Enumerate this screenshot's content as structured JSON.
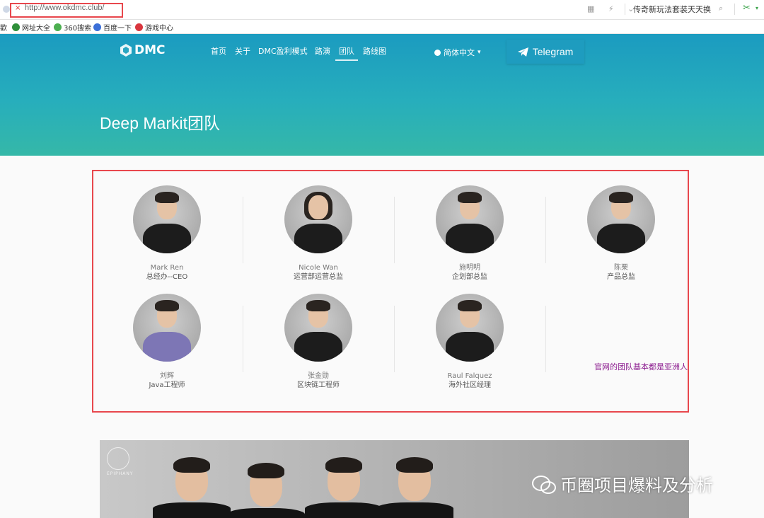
{
  "browser": {
    "close_glyph": "×",
    "url": "http://www.okdmc.club/",
    "toolbar_icons": "▦ ⚡ ⌄",
    "hot_search": "传奇新玩法套装天天换",
    "search_icon_glyph": "⌕",
    "scissor_glyph": "✂",
    "caret_glyph": "▾",
    "bookmarks": [
      {
        "label": "歡",
        "icon": "none"
      },
      {
        "label": "网址大全",
        "icon": "nav-icon",
        "color": "#2f8f3a"
      },
      {
        "label": "360搜索",
        "icon": "360-icon",
        "color": "#4caf50"
      },
      {
        "label": "百度一下",
        "icon": "baidu-icon",
        "color": "#3b6fd8"
      },
      {
        "label": "游戏中心",
        "icon": "game-icon",
        "color": "#d9363e"
      }
    ]
  },
  "header": {
    "logo_text": "DMC",
    "nav": [
      "首页",
      "关于",
      "DMC盈利模式",
      "路演",
      "团队",
      "路线图"
    ],
    "active_nav": "团队",
    "language": "简体中文",
    "language_caret": "▾",
    "telegram_label": "Telegram",
    "page_title": "Deep Markit团队"
  },
  "team": {
    "members": [
      {
        "name": "Mark Ren",
        "role": "总经办--CEO"
      },
      {
        "name": "Nicole Wan",
        "role": "运营部运营总监"
      },
      {
        "name": "施明明",
        "role": "企划部总监"
      },
      {
        "name": "陈栗",
        "role": "产品总监"
      },
      {
        "name": "刘辉",
        "role": "Java工程师"
      },
      {
        "name": "张金勋",
        "role": "区块链工程师"
      },
      {
        "name": "Raul Falquez",
        "role": "海外社区经理"
      }
    ],
    "annotation": "官网的团队基本都是亚洲人"
  },
  "banner": {
    "brand": "EPIPHANY",
    "watermark": "币圈项目爆料及分析"
  },
  "colors": {
    "hero_top": "#1b9bc0",
    "hero_bottom": "#35b8a8",
    "highlight_red": "#e8474d",
    "annotation": "#8b1a8e"
  }
}
